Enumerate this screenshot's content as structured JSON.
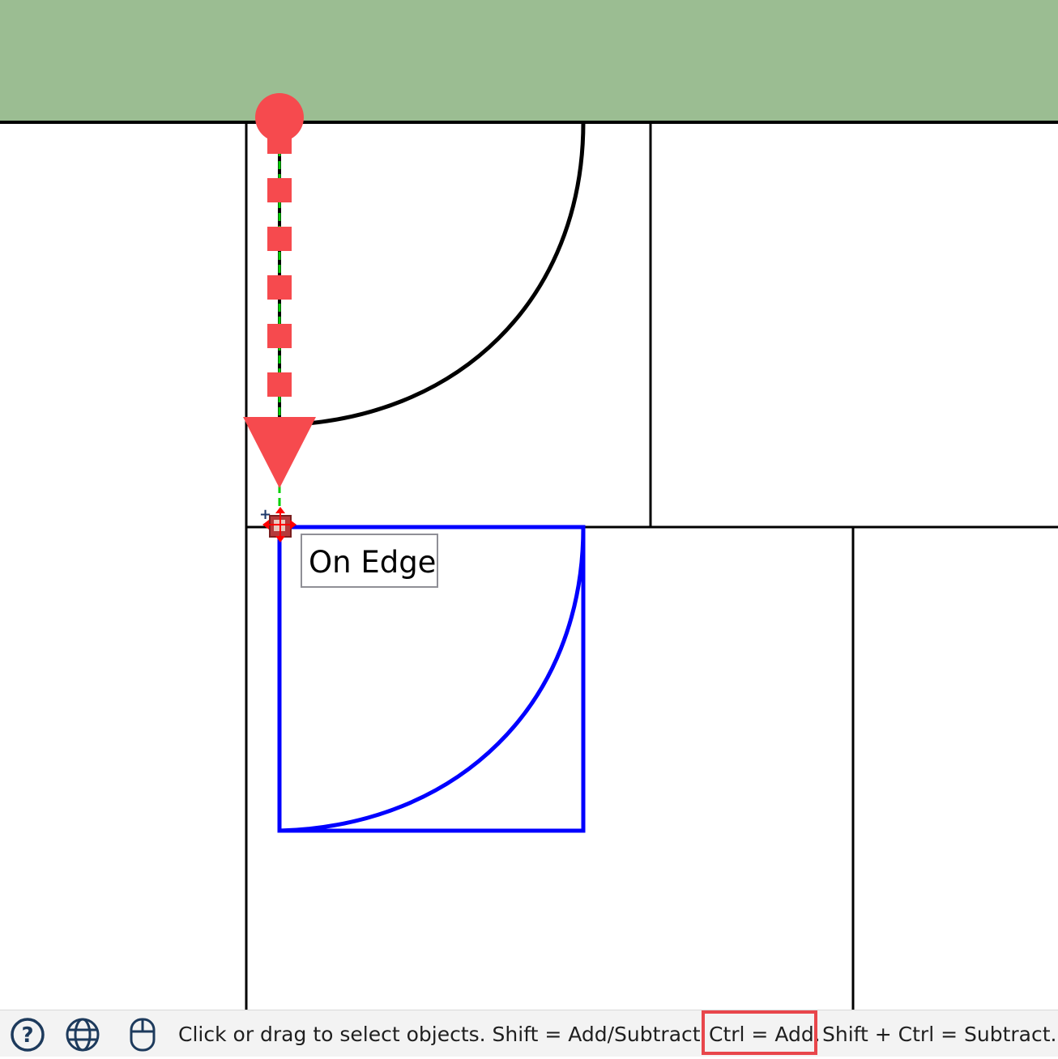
{
  "colors": {
    "header_band": "#9bbd92",
    "selection": "#0000ff",
    "arrow": "#f64a4e",
    "snap_guide": "#00d000",
    "highlight": "#e8464b"
  },
  "tooltip": {
    "text": "On Edge"
  },
  "status_bar": {
    "icons": [
      "help-icon",
      "globe-icon",
      "mouse-icon"
    ],
    "help_glyph": "?",
    "segments": {
      "main": "Click or drag to select objects. Shift = Add/Subtract.",
      "ctrl": "Ctrl = Add.",
      "shift_ctrl": "Shift + Ctrl = Subtract."
    }
  }
}
